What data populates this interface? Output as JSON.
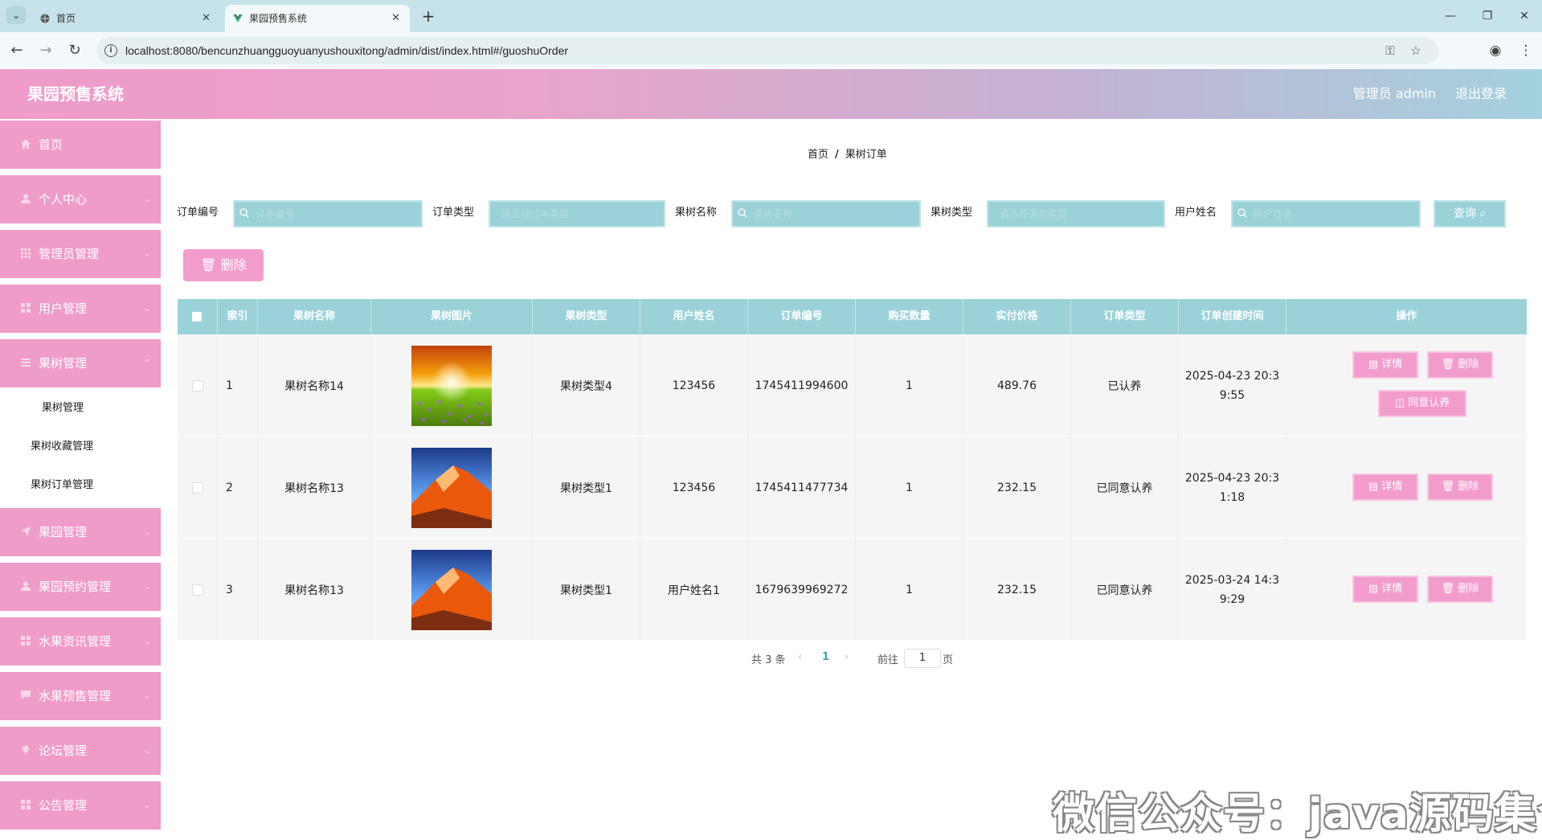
{
  "browser": {
    "tabs": [
      {
        "title": "首页",
        "active": false
      },
      {
        "title": "果园预售系统",
        "active": true
      }
    ],
    "url": "localhost:8080/bencunzhuangguoyuanyushouxitong/admin/dist/index.html#/guoshuOrder"
  },
  "header": {
    "title": "果园预售系统",
    "user": "管理员 admin",
    "logout": "退出登录"
  },
  "sidebar": {
    "items": [
      {
        "label": "首页",
        "icon": "home-icon"
      },
      {
        "label": "个人中心",
        "icon": "user-icon"
      },
      {
        "label": "管理员管理",
        "icon": "grid-icon"
      },
      {
        "label": "用户管理",
        "icon": "grid-icon"
      },
      {
        "label": "果树管理",
        "icon": "list-icon"
      },
      {
        "label": "果园管理",
        "icon": "send-icon"
      },
      {
        "label": "果园预约管理",
        "icon": "user-icon"
      },
      {
        "label": "水果资讯管理",
        "icon": "grid-icon"
      },
      {
        "label": "水果预售管理",
        "icon": "chat-icon"
      },
      {
        "label": "论坛管理",
        "icon": "pin-icon"
      },
      {
        "label": "公告管理",
        "icon": "grid-icon"
      }
    ],
    "submenu": [
      "果树管理",
      "果树收藏管理",
      "果树订单管理"
    ]
  },
  "breadcrumb": {
    "home": "首页",
    "sep": "/",
    "current": "果树订单"
  },
  "filters": [
    {
      "label": "订单编号",
      "placeholder": "订单编号"
    },
    {
      "label": "订单类型",
      "placeholder": "请选择订单类型"
    },
    {
      "label": "果树名称",
      "placeholder": "果树名称"
    },
    {
      "label": "果树类型",
      "placeholder": "请选择果树类型"
    },
    {
      "label": "用户姓名",
      "placeholder": "用户姓名"
    }
  ],
  "actions": {
    "query": "查询",
    "delete": "删除"
  },
  "table": {
    "headers": [
      "索引",
      "果树名称",
      "果树图片",
      "果树类型",
      "用户姓名",
      "订单编号",
      "购买数量",
      "实付价格",
      "订单类型",
      "订单创建时间",
      "操作"
    ],
    "rows": [
      {
        "index": "1",
        "name": "果树名称14",
        "image": "sunset-field",
        "type": "果树类型4",
        "user": "123456",
        "order_no": "1745411994600",
        "qty": "1",
        "price": "489.76",
        "order_type": "已认养",
        "time_a": "2025-04-23 20:3",
        "time_b": "9:55",
        "buttons": [
          "详情",
          "删除",
          "同意认养"
        ]
      },
      {
        "index": "2",
        "name": "果树名称13",
        "image": "orange-rock",
        "type": "果树类型1",
        "user": "123456",
        "order_no": "1745411477734",
        "qty": "1",
        "price": "232.15",
        "order_type": "已同意认养",
        "time_a": "2025-04-23 20:3",
        "time_b": "1:18",
        "buttons": [
          "详情",
          "删除"
        ]
      },
      {
        "index": "3",
        "name": "果树名称13",
        "image": "orange-rock",
        "type": "果树类型1",
        "user": "用户姓名1",
        "order_no": "1679639969272",
        "qty": "1",
        "price": "232.15",
        "order_type": "已同意认养",
        "time_a": "2025-03-24 14:3",
        "time_b": "9:29",
        "buttons": [
          "详情",
          "删除"
        ]
      }
    ]
  },
  "pagination": {
    "total": "共 3 条",
    "current": "1",
    "goto": "前往",
    "page_value": "1",
    "page_unit": "页"
  },
  "watermark": "微信公众号：java源码集合",
  "colors": {
    "pink": "#ef9cc9",
    "teal": "#9bd2da",
    "button_pink": "#f29ccd"
  }
}
